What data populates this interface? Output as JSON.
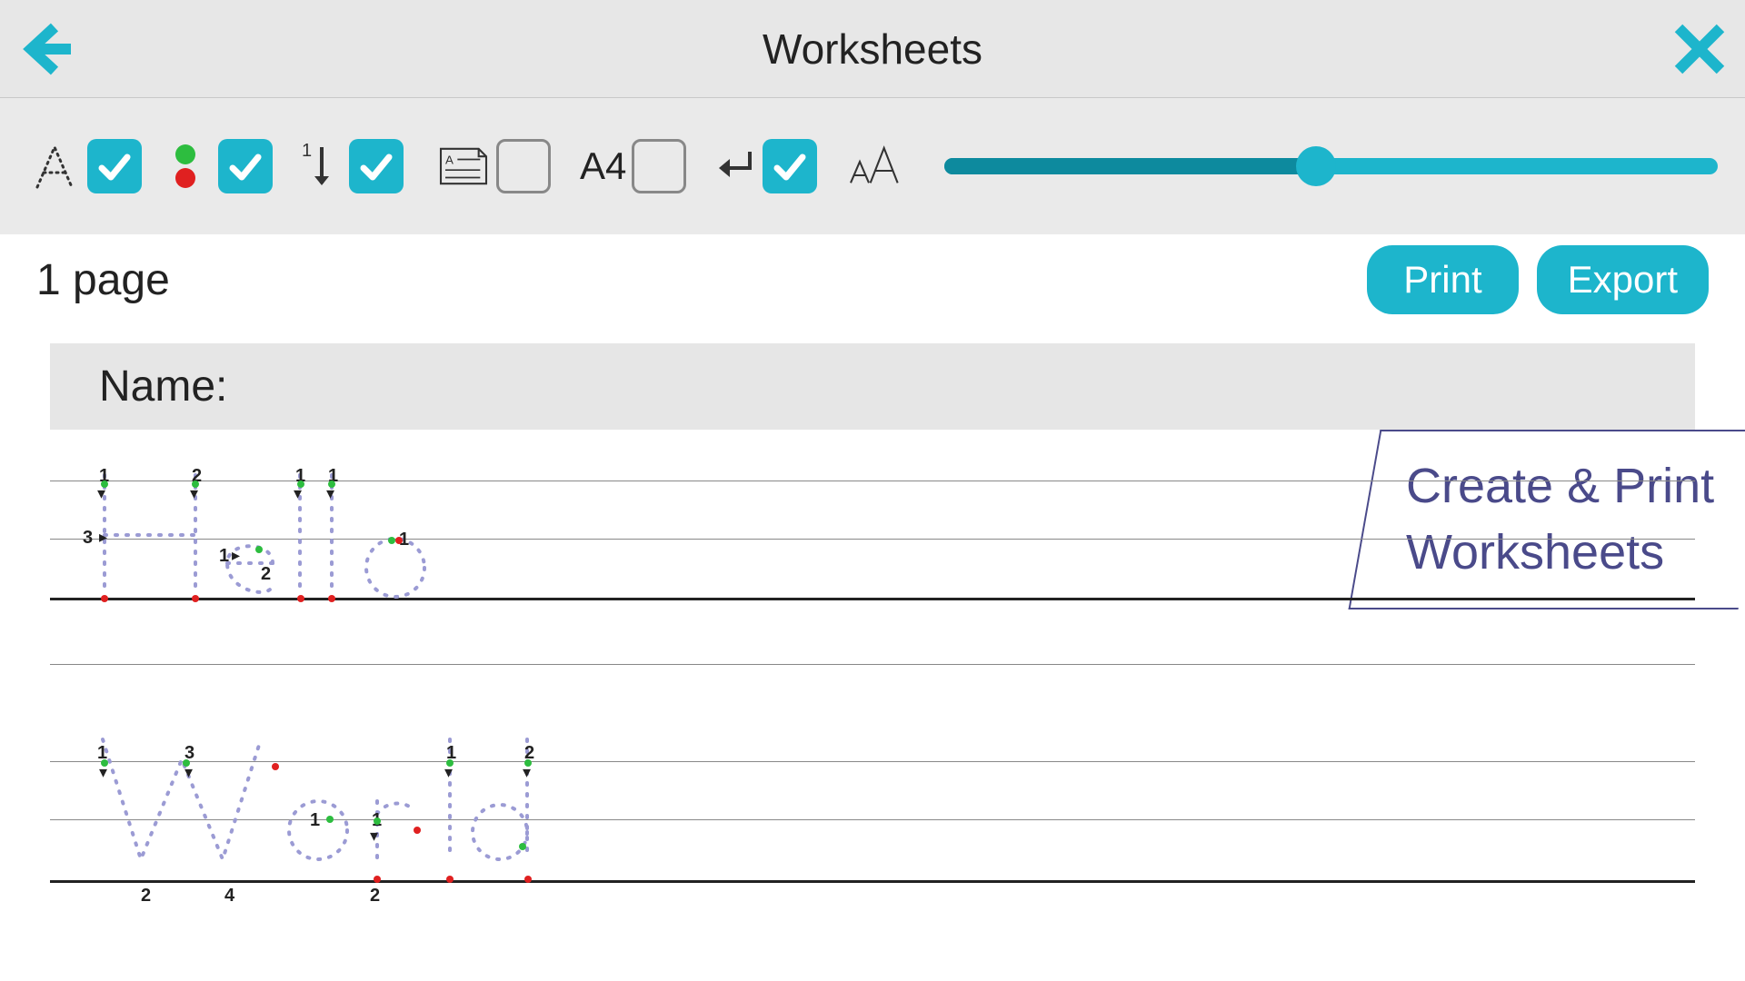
{
  "header": {
    "title": "Worksheets"
  },
  "toolbar": {
    "dotted_letters": {
      "checked": true
    },
    "color_dots": {
      "checked": true
    },
    "stroke_order": {
      "checked": true
    },
    "lined_paper": {
      "checked": false
    },
    "paper_size": {
      "label": "A4",
      "checked": false
    },
    "newline": {
      "checked": true
    },
    "size_slider": {
      "value": 48
    }
  },
  "actions": {
    "page_count": "1 page",
    "print_label": "Print",
    "export_label": "Export"
  },
  "worksheet": {
    "name_label": "Name:",
    "lines": [
      "Hello",
      "World"
    ]
  },
  "callout": {
    "line1": "Create & Print",
    "line2": "Worksheets"
  },
  "colors": {
    "accent": "#1db5cc",
    "callout_border": "#4a4a8a",
    "trace": "#9b9bd4"
  }
}
